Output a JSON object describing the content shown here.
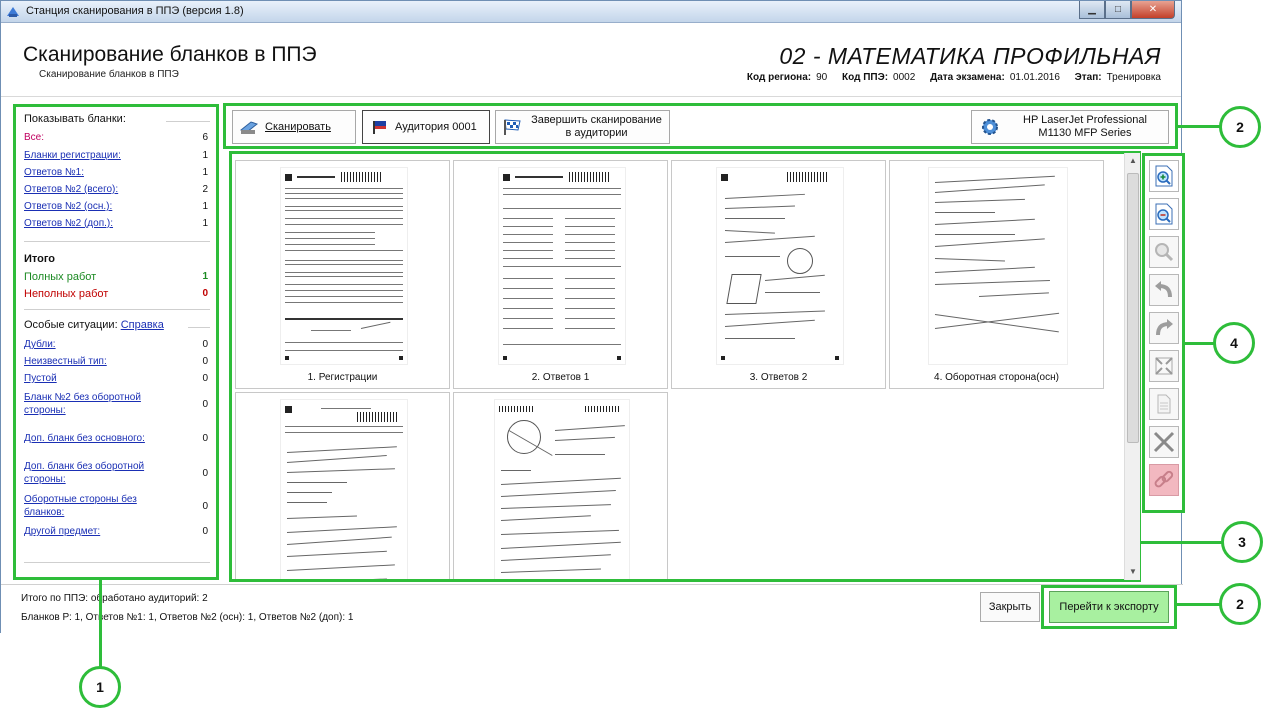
{
  "window": {
    "title": "Станция сканирования в ППЭ (версия 1.8)",
    "controls": [
      "minimize-icon",
      "maximize-icon",
      "close-icon"
    ]
  },
  "header": {
    "title": "Сканирование бланков в ППЭ",
    "subtitle": "Сканирование бланков в ППЭ",
    "subject": "02 - МАТЕМАТИКА ПРОФИЛЬНАЯ",
    "region_label": "Код региона:",
    "region_value": "90",
    "ppe_label": "Код ППЭ:",
    "ppe_value": "0002",
    "date_label": "Дата экзамена:",
    "date_value": "01.01.2016",
    "stage_label": "Этап:",
    "stage_value": "Тренировка"
  },
  "sidebar": {
    "show_title": "Показывать бланки:",
    "filters": [
      {
        "label": "Все:",
        "count": "6"
      },
      {
        "label": "Бланки регистрации:",
        "count": "1"
      },
      {
        "label": "Ответов №1:",
        "count": "1"
      },
      {
        "label": "Ответов №2 (всего):",
        "count": "2"
      },
      {
        "label": "Ответов №2 (осн.):",
        "count": "1"
      },
      {
        "label": "Ответов №2 (доп.):",
        "count": "1"
      }
    ],
    "total_title": "Итого",
    "full_label": "Полных работ",
    "full_count": "1",
    "partial_label": "Неполных работ",
    "partial_count": "0",
    "special_title": "Особые ситуации:",
    "help_link": "Справка",
    "special": [
      {
        "label": "Дубли:",
        "count": "0"
      },
      {
        "label": "Неизвестный тип:",
        "count": "0"
      },
      {
        "label": "Пустой",
        "count": "0"
      },
      {
        "label": "Бланк №2 без оборотной стороны:",
        "count": "0"
      },
      {
        "label": "Доп. бланк без основного:",
        "count": "0"
      },
      {
        "label": "Доп. бланк без оборотной стороны:",
        "count": "0"
      },
      {
        "label": "Оборотные стороны без бланков:",
        "count": "0"
      },
      {
        "label": "Другой предмет:",
        "count": "0"
      }
    ]
  },
  "toolbar": {
    "scan_label": "Сканировать",
    "room_label": "Аудитория 0001",
    "finish_label": "Завершить сканирование в аудитории",
    "printer_label": "HP LaserJet Professional M1130 MFP Series"
  },
  "gallery": {
    "captions": [
      "1. Регистрации",
      "2. Ответов 1",
      "3. Ответов 2",
      "4. Оборотная сторона(осн)"
    ]
  },
  "tools": [
    "zoom-in-icon",
    "zoom-out-icon",
    "magnifier-icon",
    "rotate-left-icon",
    "rotate-right-icon",
    "fit-icon",
    "page-icon",
    "delete-icon",
    "link-icon"
  ],
  "footer": {
    "line1": "Итого по ППЭ: обработано аудиторий: 2",
    "line2": "Бланков Р: 1, Ответов №1: 1, Ответов №2 (осн): 1, Ответов №2 (доп): 1",
    "close_label": "Закрыть",
    "export_label": "Перейти к экспорту"
  },
  "callouts": {
    "c1": "1",
    "c2a": "2",
    "c2b": "2",
    "c3": "3",
    "c4": "4"
  },
  "colors": {
    "highlight": "#2ebd3a",
    "export_button": "#a8f0a0",
    "link": "#1a2fb4",
    "full_works": "#1b8a22",
    "partial_works": "#c00000"
  }
}
